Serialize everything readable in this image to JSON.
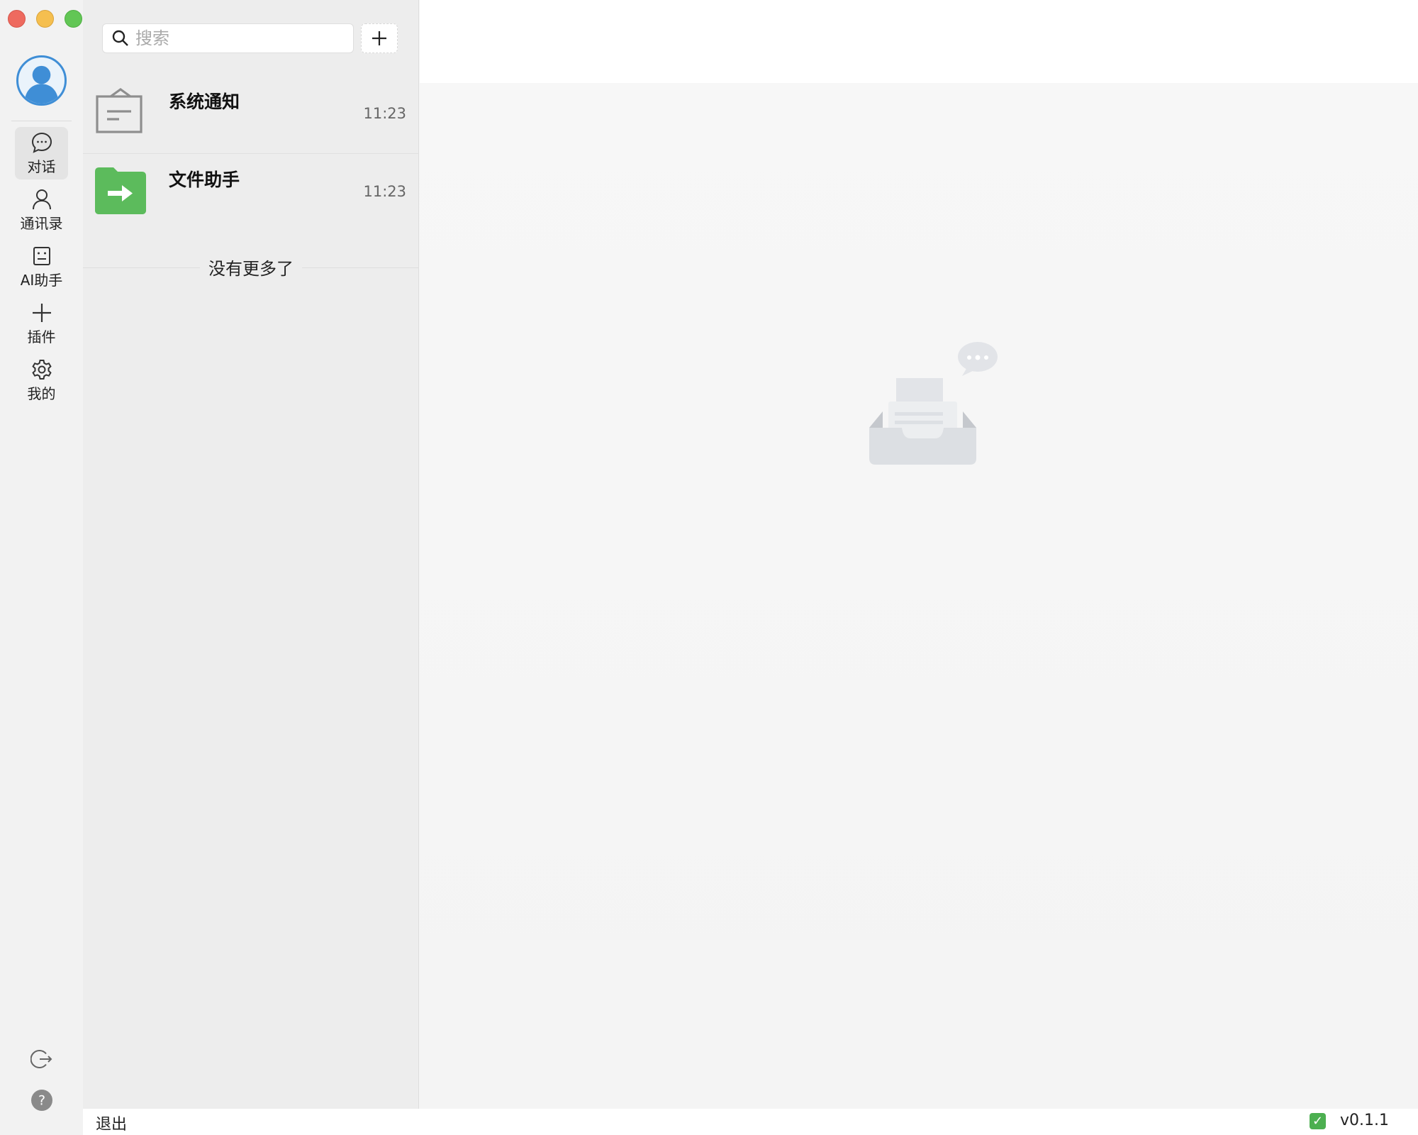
{
  "window": {
    "controls": [
      "close",
      "minimize",
      "maximize"
    ]
  },
  "sidebar": {
    "avatar_icon": "user-avatar-icon",
    "items": [
      {
        "label": "对话",
        "icon": "chat-bubble-icon",
        "active": true
      },
      {
        "label": "通讯录",
        "icon": "person-icon",
        "active": false
      },
      {
        "label": "AI助手",
        "icon": "robot-icon",
        "active": false
      },
      {
        "label": "插件",
        "icon": "plus-icon",
        "active": false
      },
      {
        "label": "我的",
        "icon": "gear-icon",
        "active": false
      }
    ],
    "bottom_icons": [
      "logout-icon",
      "help-icon"
    ]
  },
  "list": {
    "search_placeholder": "搜索",
    "add_button_icon": "plus-icon",
    "conversations": [
      {
        "name": "系统通知",
        "time": "11:23",
        "icon": "notice-board-icon"
      },
      {
        "name": "文件助手",
        "time": "11:23",
        "icon": "folder-arrow-icon"
      }
    ],
    "end_text": "没有更多了"
  },
  "main": {
    "empty_icon": "empty-inbox-icon"
  },
  "status_bar": {
    "logout_label": "退出",
    "status_icon": "check-icon",
    "status_mark": "✓",
    "version": "v0.1.1"
  },
  "colors": {
    "accent": "#3f8ed6",
    "file_helper_green": "#5cbb5c",
    "rail_bg": "#f2f2f2",
    "list_bg": "#ededed",
    "main_bg": "#f5f5f5"
  }
}
